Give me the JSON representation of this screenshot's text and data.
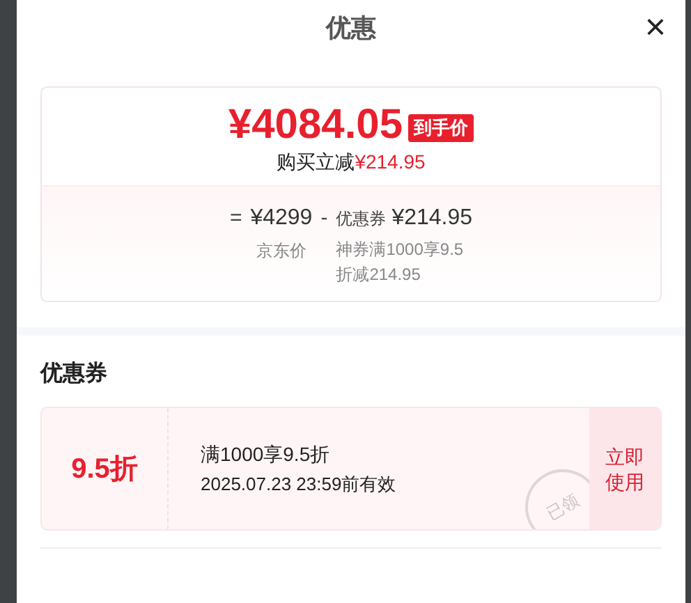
{
  "dialog": {
    "title": "优惠",
    "close": "×"
  },
  "price_card": {
    "final_price": "¥4084.05",
    "final_tag": "到手价",
    "saving_label": "购买立减",
    "saving_amount": "¥214.95",
    "breakdown": {
      "equals": "=",
      "base_price": "¥4299",
      "base_label": "京东价",
      "minus": "-",
      "coupon_label": "优惠券",
      "coupon_amount": "¥214.95",
      "coupon_note": "神券满1000享9.5\n折减214.95"
    }
  },
  "coupons_section": {
    "heading": "优惠券",
    "coupons": [
      {
        "discount": "9.5折",
        "condition": "满1000享9.5折",
        "validity": "2025.07.23 23:59前有效",
        "stamp": "已领",
        "claimed": true,
        "action": "立即使用"
      }
    ]
  }
}
